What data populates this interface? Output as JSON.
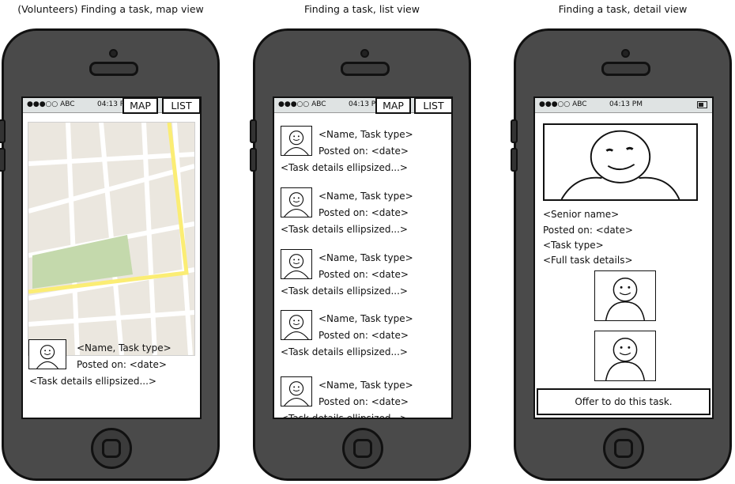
{
  "captions": {
    "map_view": "(Volunteers) Finding a task, map view",
    "list_view": "Finding a task, list view",
    "detail_view": "Finding a task, detail view"
  },
  "status_bar": {
    "signal": "●●●○○ ABC",
    "time_short": "04:13 P",
    "time_full": "04:13 PM"
  },
  "tabs": {
    "map": "MAP",
    "list": "LIST"
  },
  "task_item": {
    "title": "<Name, Task type>",
    "posted": "Posted on: <date>",
    "details": "<Task details ellipsized...>"
  },
  "list_items": [
    {
      "title": "<Name, Task type>",
      "posted": "Posted on: <date>",
      "details": "<Task details ellipsized...>"
    },
    {
      "title": "<Name, Task type>",
      "posted": "Posted on: <date>",
      "details": "<Task details ellipsized...>"
    },
    {
      "title": "<Name, Task type>",
      "posted": "Posted on: <date>",
      "details": "<Task details ellipsized...>"
    },
    {
      "title": "<Name, Task type>",
      "posted": "Posted on: <date>",
      "details": "<Task details ellipsized...>"
    },
    {
      "title": "<Name, Task type>",
      "posted": "Posted on: <date>",
      "details": "<Task details ellipsized...>"
    }
  ],
  "detail": {
    "senior_name": "<Senior name>",
    "posted": "Posted on: <date>",
    "task_type": "<Task type>",
    "full_details": "<Full task details>",
    "offer_button": "Offer to do this task."
  },
  "colors": {
    "phone_body": "#4a4a4a",
    "map_land": "#ebe7df",
    "map_park": "#c4d9ac",
    "map_route": "#fbed74"
  },
  "icons": {
    "avatar": "smiley-face-icon"
  }
}
